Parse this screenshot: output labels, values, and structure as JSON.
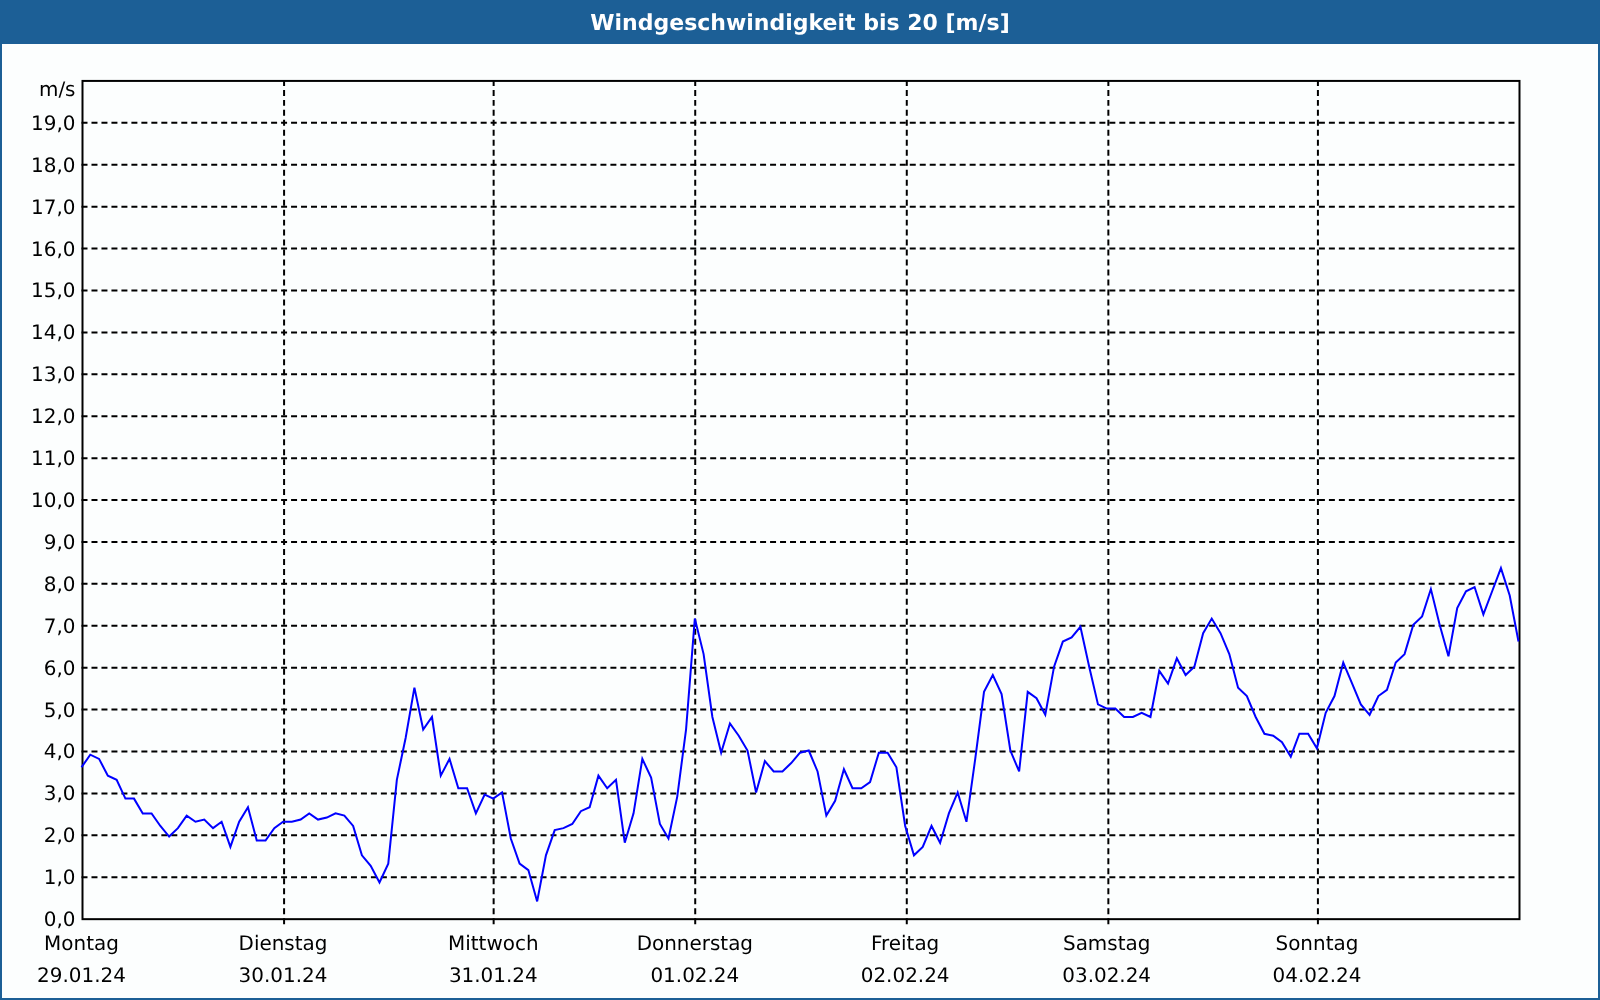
{
  "chart_data": {
    "type": "line",
    "title": "Windgeschwindigkeit bis 20 [m/s]",
    "ylabel": "m/s",
    "grid": true,
    "ylim": [
      0,
      20
    ],
    "yticks": [
      {
        "value": 0,
        "label": "0,0"
      },
      {
        "value": 1,
        "label": "1,0"
      },
      {
        "value": 2,
        "label": "2,0"
      },
      {
        "value": 3,
        "label": "3,0"
      },
      {
        "value": 4,
        "label": "4,0"
      },
      {
        "value": 5,
        "label": "5,0"
      },
      {
        "value": 6,
        "label": "6,0"
      },
      {
        "value": 7,
        "label": "7,0"
      },
      {
        "value": 8,
        "label": "8,0"
      },
      {
        "value": 9,
        "label": "9,0"
      },
      {
        "value": 10,
        "label": "10,0"
      },
      {
        "value": 11,
        "label": "11,0"
      },
      {
        "value": 12,
        "label": "12,0"
      },
      {
        "value": 13,
        "label": "13,0"
      },
      {
        "value": 14,
        "label": "14,0"
      },
      {
        "value": 15,
        "label": "15,0"
      },
      {
        "value": 16,
        "label": "16,0"
      },
      {
        "value": 17,
        "label": "17,0"
      },
      {
        "value": 18,
        "label": "18,0"
      },
      {
        "value": 19,
        "label": "19,0"
      }
    ],
    "categories": [
      "Montag\n29.01.24",
      null,
      null,
      null,
      null,
      null,
      null,
      null,
      null,
      null,
      null,
      null,
      null,
      null,
      null,
      null,
      null,
      null,
      null,
      null,
      null,
      null,
      null,
      "Dienstag\n30.01.24",
      null,
      null,
      null,
      null,
      null,
      null,
      null,
      null,
      null,
      null,
      null,
      null,
      null,
      null,
      null,
      null,
      null,
      null,
      null,
      null,
      null,
      null,
      null,
      "Mittwoch\n31.01.24",
      null,
      null,
      null,
      null,
      null,
      null,
      null,
      null,
      null,
      null,
      null,
      null,
      null,
      null,
      null,
      null,
      null,
      null,
      null,
      null,
      null,
      null,
      "Donnerstag\n01.02.24",
      null,
      null,
      null,
      null,
      null,
      null,
      null,
      null,
      null,
      null,
      null,
      null,
      null,
      null,
      null,
      null,
      null,
      null,
      null,
      null,
      null,
      null,
      null,
      "Freitag\n02.02.24",
      null,
      null,
      null,
      null,
      null,
      null,
      null,
      null,
      null,
      null,
      null,
      null,
      null,
      null,
      null,
      null,
      null,
      null,
      null,
      null,
      null,
      null,
      "Samstag\n03.02.24",
      null,
      null,
      null,
      null,
      null,
      null,
      null,
      null,
      null,
      null,
      null,
      null,
      null,
      null,
      null,
      null,
      null,
      null,
      null,
      null,
      null,
      null,
      null,
      "Sonntag\n04.02.24",
      null,
      null,
      null,
      null,
      null,
      null,
      null,
      null,
      null,
      null,
      null,
      null,
      null,
      null,
      null,
      null,
      null,
      null,
      null,
      null,
      null,
      null,
      null
    ],
    "series": [
      {
        "color": "#0000ff",
        "values": [
          3.6,
          3.9,
          3.8,
          3.4,
          3.3,
          2.85,
          2.85,
          2.5,
          2.5,
          2.2,
          1.95,
          2.15,
          2.45,
          2.3,
          2.35,
          2.15,
          2.3,
          1.7,
          2.3,
          2.65,
          1.85,
          1.85,
          2.15,
          2.3,
          2.3,
          2.35,
          2.5,
          2.35,
          2.4,
          2.5,
          2.45,
          2.2,
          1.5,
          1.25,
          0.85,
          1.3,
          3.3,
          4.3,
          5.5,
          4.5,
          4.8,
          3.4,
          3.8,
          3.1,
          3.1,
          2.5,
          2.95,
          2.85,
          3.0,
          1.9,
          1.3,
          1.15,
          0.4,
          1.5,
          2.1,
          2.15,
          2.25,
          2.55,
          2.65,
          3.4,
          3.1,
          3.3,
          1.8,
          2.5,
          3.8,
          3.35,
          2.25,
          1.9,
          2.9,
          4.5,
          7.15,
          6.3,
          4.8,
          3.95,
          4.65,
          4.35,
          4.0,
          3.0,
          3.75,
          3.5,
          3.5,
          3.7,
          3.95,
          4.0,
          3.5,
          2.45,
          2.8,
          3.55,
          3.1,
          3.1,
          3.25,
          3.95,
          3.95,
          3.6,
          2.2,
          1.5,
          1.7,
          2.2,
          1.8,
          2.5,
          3.0,
          2.3,
          3.8,
          5.4,
          5.8,
          5.35,
          4.0,
          3.5,
          5.4,
          5.25,
          4.85,
          6.0,
          6.6,
          6.7,
          6.95,
          6.0,
          5.1,
          5.0,
          5.0,
          4.8,
          4.8,
          4.9,
          4.8,
          5.9,
          5.6,
          6.2,
          5.8,
          6.0,
          6.8,
          7.15,
          6.8,
          6.3,
          5.5,
          5.3,
          4.8,
          4.4,
          4.35,
          4.2,
          3.85,
          4.4,
          4.4,
          4.05,
          4.9,
          5.3,
          6.1,
          5.6,
          5.1,
          4.85,
          5.3,
          5.45,
          6.1,
          6.3,
          7.0,
          7.2,
          7.85,
          7.0,
          6.25,
          7.4,
          7.8,
          7.9,
          7.25,
          7.8,
          8.35,
          7.7,
          6.6
        ]
      }
    ]
  }
}
